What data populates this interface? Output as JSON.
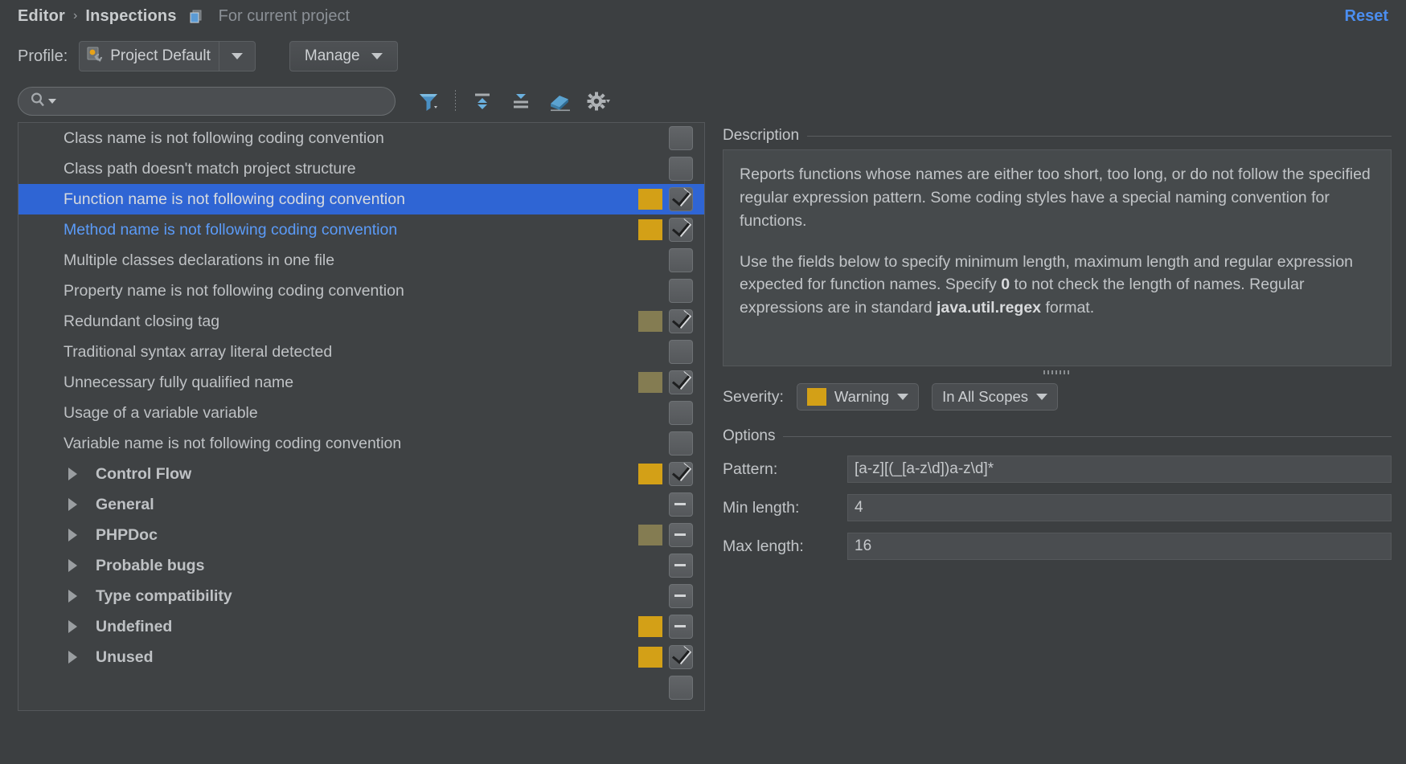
{
  "header": {
    "breadcrumb_root": "Editor",
    "breadcrumb_sep": "›",
    "breadcrumb_current": "Inspections",
    "scope_note": "For current project",
    "copy_icon": "copy-profile-icon",
    "reset_label": "Reset",
    "reset_color": "#4b8ef0"
  },
  "profile_bar": {
    "label": "Profile:",
    "selected_profile": "Project Default",
    "profile_icon": "inspection-profile-icon",
    "manage_label": "Manage"
  },
  "toolbar": {
    "search_value": "",
    "search_placeholder": "",
    "search_icon": "search-icon",
    "buttons": [
      {
        "name": "filter-icon",
        "title": "Filter inspections"
      },
      {
        "name": "expand-all-icon",
        "title": "Expand all"
      },
      {
        "name": "collapse-all-icon",
        "title": "Collapse all"
      },
      {
        "name": "eraser-icon",
        "title": "Reset to empty"
      },
      {
        "name": "gear-icon",
        "title": "Settings"
      }
    ]
  },
  "tree": {
    "rows": [
      {
        "label": "Class name is not following coding convention",
        "type": "item",
        "severity": "none",
        "checked": false,
        "selected": false,
        "link": false
      },
      {
        "label": "Class path doesn't match project structure",
        "type": "item",
        "severity": "none",
        "checked": false,
        "selected": false,
        "link": false
      },
      {
        "label": "Function name is not following coding convention",
        "type": "item",
        "severity": "warning",
        "checked": true,
        "selected": true,
        "link": false
      },
      {
        "label": "Method name is not following coding convention",
        "type": "item",
        "severity": "warning",
        "checked": true,
        "selected": false,
        "link": true
      },
      {
        "label": "Multiple classes declarations in one file",
        "type": "item",
        "severity": "none",
        "checked": false,
        "selected": false,
        "link": false
      },
      {
        "label": "Property name is not following coding convention",
        "type": "item",
        "severity": "none",
        "checked": false,
        "selected": false,
        "link": false
      },
      {
        "label": "Redundant closing tag",
        "type": "item",
        "severity": "warning-muted",
        "checked": true,
        "selected": false,
        "link": false
      },
      {
        "label": "Traditional syntax array literal detected",
        "type": "item",
        "severity": "none",
        "checked": false,
        "selected": false,
        "link": false
      },
      {
        "label": "Unnecessary fully qualified name",
        "type": "item",
        "severity": "warning-muted",
        "checked": true,
        "selected": false,
        "link": false
      },
      {
        "label": "Usage of a variable variable",
        "type": "item",
        "severity": "none",
        "checked": false,
        "selected": false,
        "link": false
      },
      {
        "label": "Variable name is not following coding convention",
        "type": "item",
        "severity": "none",
        "checked": false,
        "selected": false,
        "link": false
      },
      {
        "label": "Control Flow",
        "type": "group",
        "severity": "warning",
        "checked": true,
        "selected": false,
        "link": false
      },
      {
        "label": "General",
        "type": "group",
        "severity": "none",
        "checked": "mixed",
        "selected": false,
        "link": false
      },
      {
        "label": "PHPDoc",
        "type": "group",
        "severity": "warning-muted",
        "checked": "mixed",
        "selected": false,
        "link": false
      },
      {
        "label": "Probable bugs",
        "type": "group",
        "severity": "none",
        "checked": "mixed",
        "selected": false,
        "link": false
      },
      {
        "label": "Type compatibility",
        "type": "group",
        "severity": "none",
        "checked": "mixed",
        "selected": false,
        "link": false
      },
      {
        "label": "Undefined",
        "type": "group",
        "severity": "warning",
        "checked": "mixed",
        "selected": false,
        "link": false
      },
      {
        "label": "Unused",
        "type": "group",
        "severity": "warning",
        "checked": true,
        "selected": false,
        "link": false
      }
    ],
    "colors": {
      "warning": "#d3a017",
      "warning_muted": "#847c52",
      "selection": "#2f65d4",
      "link_text": "#5b9bf8"
    }
  },
  "detail": {
    "description_title": "Description",
    "description_paragraphs": [
      "Reports functions whose names are either too short, too long, or do not follow the specified regular expression pattern. Some coding styles have a special naming convention for functions.",
      "Use the fields below to specify minimum length, maximum length and regular expression expected for function names. Specify 0 to not check the length of names. Regular expressions are in standard java.util.regex format."
    ],
    "severity_label": "Severity:",
    "severity_value": "Warning",
    "severity_color": "#d3a017",
    "scope_value": "In All Scopes",
    "options_title": "Options",
    "options": [
      {
        "label": "Pattern:",
        "value": "[a-z][(_[a-z\\d])a-z\\d]*"
      },
      {
        "label": "Min length:",
        "value": "4"
      },
      {
        "label": "Max length:",
        "value": "16"
      }
    ]
  }
}
